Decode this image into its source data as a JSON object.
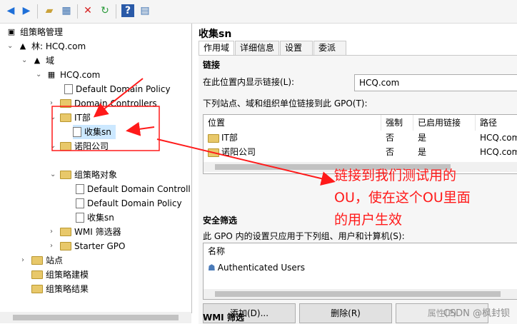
{
  "toolbar": {
    "icons": [
      "back-arrow-icon",
      "forward-arrow-icon",
      "folder-up-icon",
      "grid-view-icon",
      "delete-x-icon",
      "refresh-icon",
      "help-icon",
      "panel-icon"
    ]
  },
  "tree": {
    "root": "组策略管理",
    "forest": "林: HCQ.com",
    "domains": "域",
    "domain": "HCQ.com",
    "default_policy": "Default Domain Policy",
    "domain_controllers": "Domain Controllers",
    "it_ou": "IT部",
    "gpo_link": "收集sn",
    "company_ou": "诺阳公司",
    "gpo_objects": "组策略对象",
    "gpo_items": [
      "Default Domain Controll",
      "Default Domain Policy",
      "收集sn"
    ],
    "wmi": "WMI 筛选器",
    "starter": "Starter GPO",
    "sites": "站点",
    "modeling": "组策略建模",
    "results": "组策略结果"
  },
  "detail": {
    "title": "收集sn",
    "tabs": [
      "作用域",
      "详细信息",
      "设置",
      "委派"
    ],
    "links_heading": "链接",
    "location_label": "在此位置内显示链接(L):",
    "location_value": "HCQ.com",
    "linked_label": "下列站点、域和组织单位链接到此 GPO(T):",
    "links_columns": [
      "位置",
      "强制",
      "已启用链接",
      "路径"
    ],
    "links_rows": [
      [
        "IT部",
        "否",
        "是",
        "HCQ.com"
      ],
      [
        "诺阳公司",
        "否",
        "是",
        "HCQ.com"
      ]
    ],
    "security_heading": "安全筛选",
    "security_label": "此 GPO 内的设置只应用于下列组、用户和计算机(S):",
    "security_column": "名称",
    "security_rows": [
      "Authenticated Users"
    ],
    "buttons": {
      "add": "添加(D)...",
      "remove": "删除(R)",
      "properties": "属性(P)"
    },
    "wmi_heading": "WMI 筛选"
  },
  "annotation": {
    "line1": "链接到我们测试用的",
    "line2": "OU，使在这个OU里面",
    "line3": "的用户生效",
    "color": "#ff1a1a"
  },
  "watermark": "CSDN @枫封钡"
}
